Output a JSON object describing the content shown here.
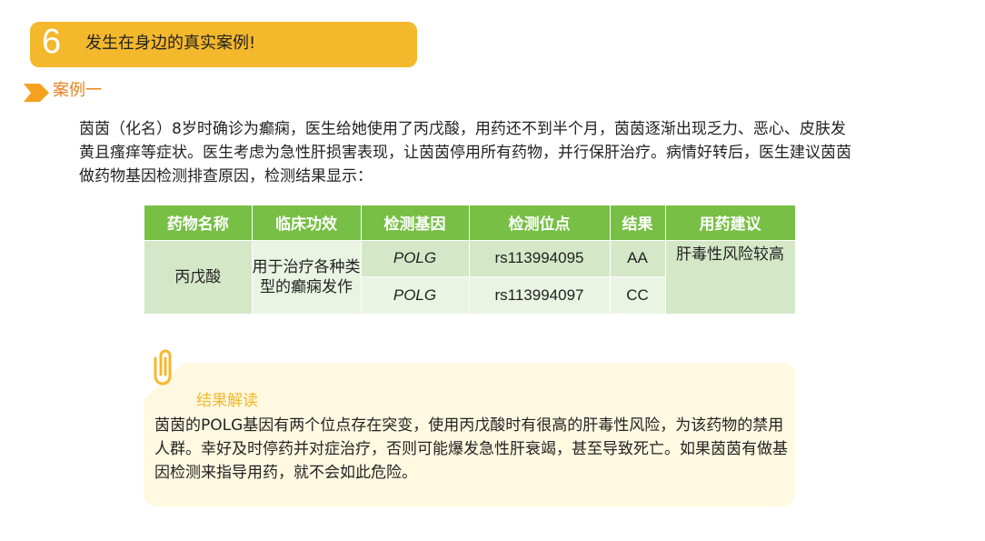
{
  "header": {
    "number": "6",
    "title": "发生在身边的真实案例!"
  },
  "case": {
    "label": "案例一"
  },
  "intro": {
    "text": "茵茵（化名）8岁时确诊为癫痫，医生给她使用了丙戊酸，用药还不到半个月，茵茵逐渐出现乏力、恶心、皮肤发黄且瘙痒等症状。医生考虑为急性肝损害表现，让茵茵停用所有药物，并行保肝治疗。病情好转后，医生建议茵茵做药物基因检测排查原因，检测结果显示："
  },
  "table": {
    "headers": [
      "药物名称",
      "临床功效",
      "检测基因",
      "检测位点",
      "结果",
      "用药建议"
    ],
    "drug": "丙戊酸",
    "efficacy": "用于治疗各种类型的癫痫发作",
    "rows": [
      {
        "gene": "POLG",
        "site": "rs113994095",
        "result": "AA"
      },
      {
        "gene": "POLG",
        "site": "rs113994097",
        "result": "CC"
      }
    ],
    "advice": "肝毒性风险较高"
  },
  "note": {
    "title": "结果解读",
    "text": "茵茵的POLG基因有两个位点存在突变，使用丙戊酸时有很高的肝毒性风险，为该药物的禁用人群。幸好及时停药并对症治疗，否则可能爆发急性肝衰竭，甚至导致死亡。如果茵茵有做基因检测来指导用药，就不会如此危险。"
  },
  "colors": {
    "accent_yellow": "#f4b82c",
    "accent_orange": "#e8811e",
    "table_header_green": "#77bf45",
    "table_cell_dark": "#d4e8c8",
    "table_cell_light": "#eaf4e3",
    "note_background": "#fff9e1"
  },
  "icons": [
    "chevron-arrow-icon",
    "paperclip-icon"
  ]
}
